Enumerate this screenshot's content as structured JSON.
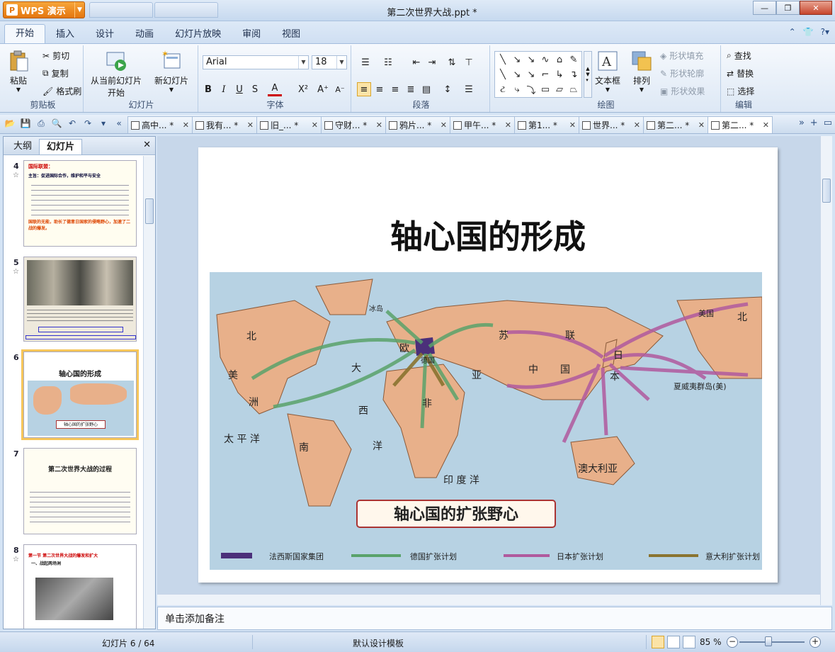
{
  "app": {
    "button_label": "WPS 演示",
    "window_title": "第二次世界大战.ppt *"
  },
  "ribbon_tabs": [
    "开始",
    "插入",
    "设计",
    "动画",
    "幻灯片放映",
    "审阅",
    "视图"
  ],
  "clipboard": {
    "paste": "粘贴",
    "cut": "剪切",
    "copy": "复制",
    "format_painter": "格式刷",
    "group": "剪贴板"
  },
  "slides_group": {
    "from_current": "从当前幻灯片",
    "start": "开始",
    "new_slide": "新幻灯片",
    "group": "幻灯片"
  },
  "font": {
    "name": "Arial",
    "size": "18",
    "group": "字体"
  },
  "paragraph": {
    "group": "段落"
  },
  "drawing": {
    "textbox": "文本框",
    "arrange": "排列",
    "shape_fill": "形状填充",
    "shape_outline": "形状轮廓",
    "shape_effect": "形状效果",
    "group": "绘图"
  },
  "editing": {
    "find": "查找",
    "replace": "替换",
    "select": "选择",
    "group": "编辑"
  },
  "doc_tabs": [
    "高中... *",
    "我有... *",
    "旧_... *",
    "守财... *",
    "鸦片... *",
    "甲午... *",
    "第1... *",
    "世界... *",
    "第二... *",
    "第二... *"
  ],
  "left_panel": {
    "tab_outline": "大纲",
    "tab_slides": "幻灯片"
  },
  "thumbnails": {
    "s4": {
      "num": "4",
      "title": "国际联盟：",
      "subtitle": "主旨：促进国际合作，维护和平与安全",
      "foot": "国联的无能，助长了德意日国家的侵略野心，加速了二战的爆发。"
    },
    "s5": {
      "num": "5"
    },
    "s6": {
      "num": "6",
      "title": "轴心国的形成",
      "caption": "轴心国的扩张野心"
    },
    "s7": {
      "num": "7",
      "title": "第二次世界大战的过程"
    },
    "s8": {
      "num": "8",
      "title": "第一节 第二次世界大战的爆发和扩大",
      "sub": "一、战起两场洲"
    }
  },
  "slide": {
    "title": "轴心国的形成",
    "map_caption": "轴心国的扩张野心",
    "legend": [
      "法西斯国家集团",
      "德国扩张计划",
      "日本扩张计划",
      "意大利扩张计划"
    ],
    "labels": {
      "bei1": "北",
      "mei": "美",
      "zhou": "洲",
      "da": "大",
      "xi": "西",
      "yang": "洋",
      "su": "苏",
      "lian": "联",
      "zhong": "中",
      "guo": "国",
      "ri": "日",
      "ben": "本",
      "nan": "南",
      "fei": "非",
      "ya": "亚",
      "ou": "欧",
      "taiping": "太  平  洋",
      "yindu": "印  度  洋",
      "aus": "澳大利亚",
      "bingdao": "冰岛",
      "deguo": "德国",
      "xiawei": "夏威夷群岛(美)",
      "meiguo": "美国",
      "bei2": "北"
    }
  },
  "notes_placeholder": "单击添加备注",
  "status": {
    "slide_index": "幻灯片 6 / 64",
    "template": "默认设计模板",
    "zoom": "85 %"
  },
  "colors": {
    "fascist": "#4b2f7a",
    "germany": "#5aa36b",
    "japan": "#b05a9e",
    "italy": "#8a7430",
    "land": "#e8b08a",
    "sea": "#b7d2e3"
  }
}
